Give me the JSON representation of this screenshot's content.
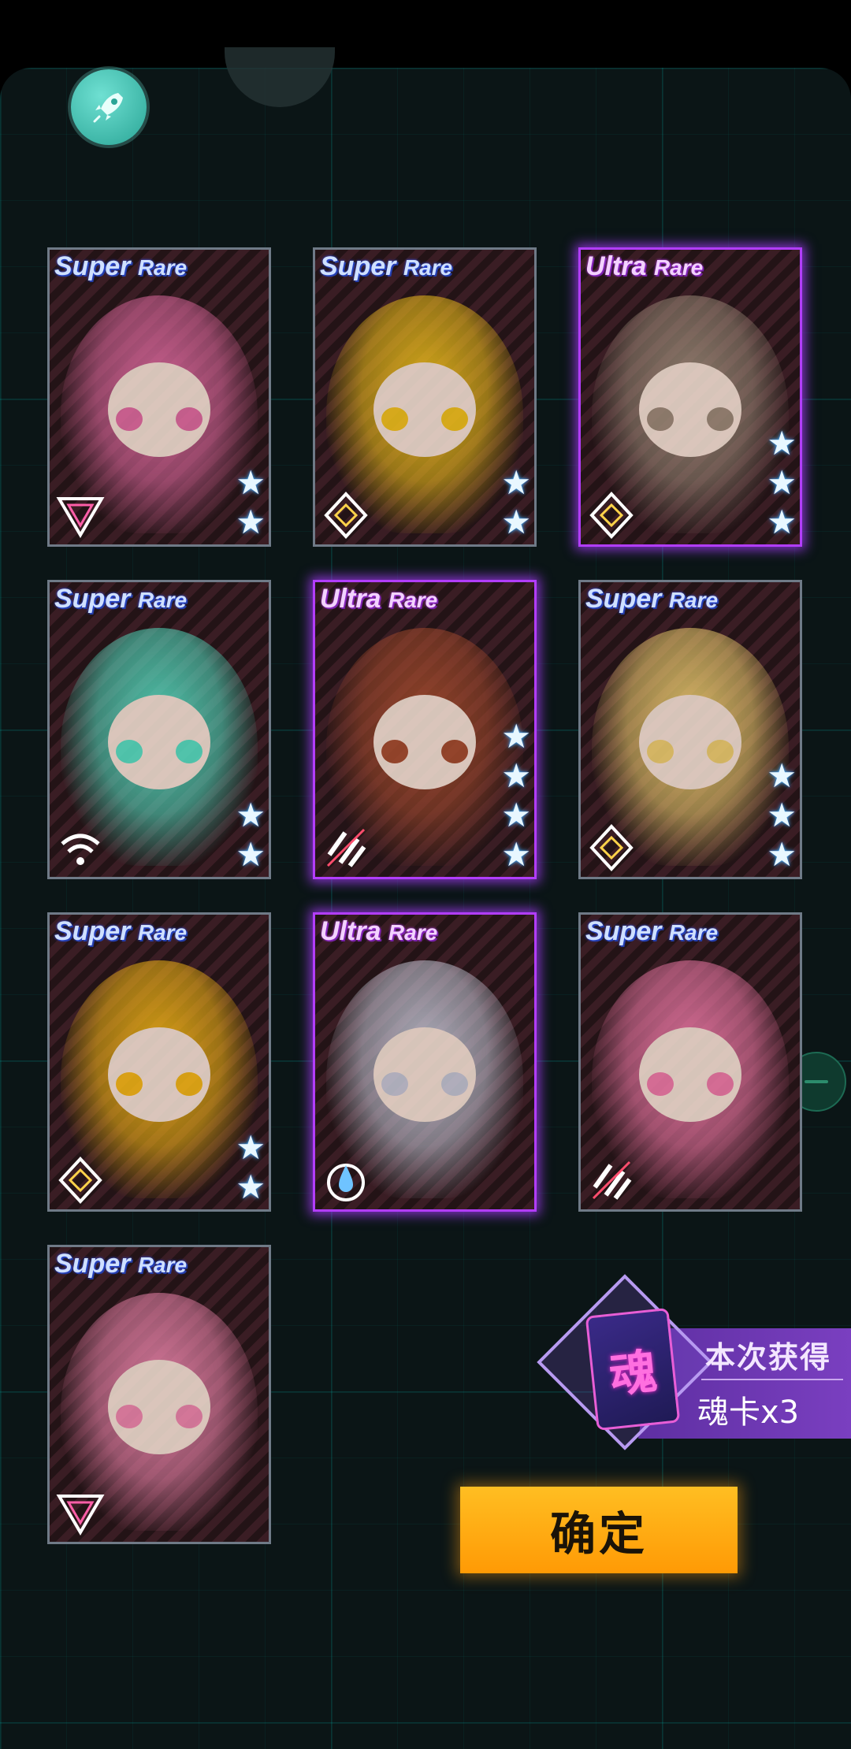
{
  "cards": [
    {
      "rarity_word1": "Super",
      "rarity_word2": "Rare",
      "tier": "super",
      "stars": 2,
      "class_icon": "triangle-class-icon",
      "accent": "#e06aa0"
    },
    {
      "rarity_word1": "Super",
      "rarity_word2": "Rare",
      "tier": "super",
      "stars": 2,
      "class_icon": "diamond-class-icon",
      "accent": "#f2c21b"
    },
    {
      "rarity_word1": "Ultra",
      "rarity_word2": "Rare",
      "tier": "ultra",
      "stars": 3,
      "class_icon": "diamond-class-icon",
      "accent": "#9c8a78"
    },
    {
      "rarity_word1": "Super",
      "rarity_word2": "Rare",
      "tier": "super",
      "stars": 2,
      "class_icon": "wifi-class-icon",
      "accent": "#56e0c3"
    },
    {
      "rarity_word1": "Ultra",
      "rarity_word2": "Rare",
      "tier": "ultra",
      "stars": 4,
      "class_icon": "slash-class-icon",
      "accent": "#a34b2d"
    },
    {
      "rarity_word1": "Super",
      "rarity_word2": "Rare",
      "tier": "super",
      "stars": 3,
      "class_icon": "diamond-class-icon",
      "accent": "#f0d070"
    },
    {
      "rarity_word1": "Super",
      "rarity_word2": "Rare",
      "tier": "super",
      "stars": 2,
      "class_icon": "diamond-class-icon",
      "accent": "#f5b715"
    },
    {
      "rarity_word1": "Ultra",
      "rarity_word2": "Rare",
      "tier": "ultra",
      "stars": 0,
      "class_icon": "drop-class-icon",
      "accent": "#c5c7d6"
    },
    {
      "rarity_word1": "Super",
      "rarity_word2": "Rare",
      "tier": "super",
      "stars": 0,
      "class_icon": "slash-class-icon",
      "accent": "#f07aa8"
    },
    {
      "rarity_word1": "Super",
      "rarity_word2": "Rare",
      "tier": "super",
      "stars": 0,
      "class_icon": "triangle-class-icon",
      "accent": "#ee86ad"
    }
  ],
  "reward": {
    "title": "本次获得",
    "amount": "魂卡x3",
    "card_glyph": "魂"
  },
  "confirm_label": "确定"
}
